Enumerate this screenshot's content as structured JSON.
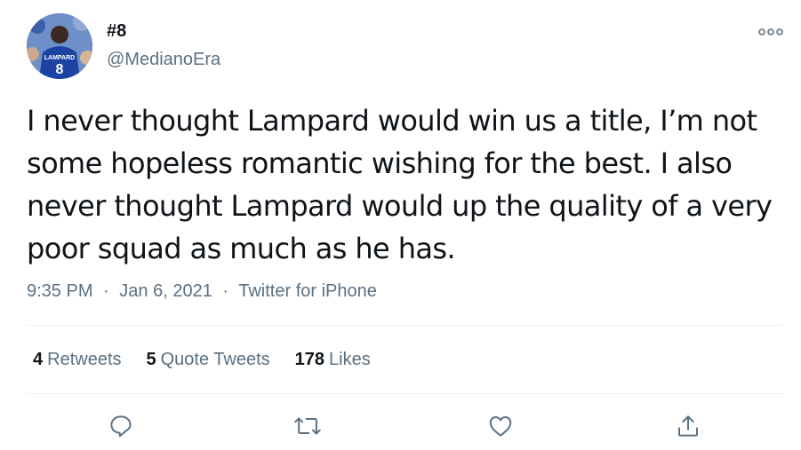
{
  "author": {
    "display_name": "#8",
    "handle": "@MedianoEra",
    "avatar_icon": "avatar-photo-chelsea-player"
  },
  "tweet": {
    "text": "I never thought Lampard would win us a title, I’m not some hopeless romantic wishing for the best. I also never thought Lampard would up the quality of a very poor squad as much as he has.",
    "time": "9:35 PM",
    "date": "Jan 6, 2021",
    "source": "Twitter for iPhone",
    "separator": "·"
  },
  "stats": {
    "retweets_count": "4",
    "retweets_label": "Retweets",
    "quote_tweets_count": "5",
    "quote_tweets_label": "Quote Tweets",
    "likes_count": "178",
    "likes_label": "Likes"
  },
  "actions": [
    "reply-icon",
    "retweet-icon",
    "like-icon",
    "share-icon"
  ],
  "colors": {
    "text_primary": "#0f1419",
    "text_secondary": "#5b7083",
    "divider": "#ebeef0",
    "icon": "#5b7083"
  }
}
